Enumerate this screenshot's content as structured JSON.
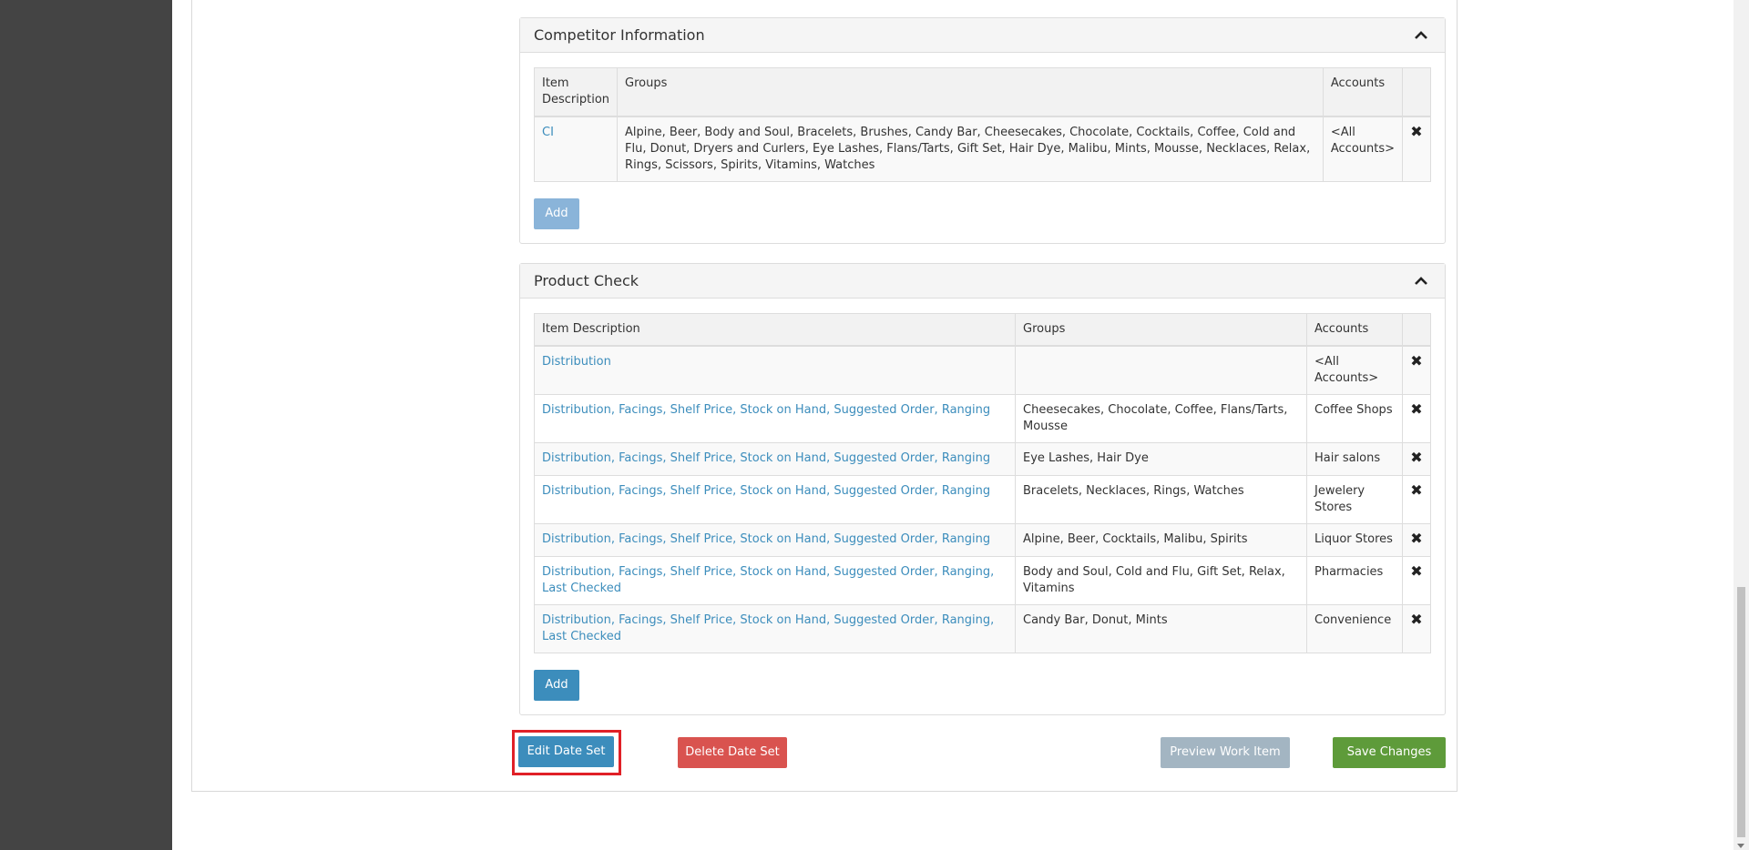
{
  "competitor_panel": {
    "title": "Competitor Information",
    "headers": [
      "Item Description",
      "Groups",
      "Accounts"
    ],
    "rows": [
      {
        "item": "CI",
        "groups": "Alpine, Beer, Body and Soul, Bracelets, Brushes, Candy Bar, Cheesecakes, Chocolate, Cocktails, Coffee, Cold and Flu, Donut, Dryers and Curlers, Eye Lashes, Flans/Tarts, Gift Set, Hair Dye, Malibu, Mints, Mousse, Necklaces, Relax, Rings, Scissors, Spirits, Vitamins, Watches",
        "accounts": "<All Accounts>"
      }
    ],
    "add_label": "Add"
  },
  "product_panel": {
    "title": "Product Check",
    "headers": [
      "Item Description",
      "Groups",
      "Accounts"
    ],
    "rows": [
      {
        "item": "Distribution",
        "groups": "",
        "accounts": "<All Accounts>"
      },
      {
        "item": "Distribution, Facings, Shelf Price, Stock on Hand, Suggested Order, Ranging",
        "groups": "Cheesecakes, Chocolate, Coffee, Flans/Tarts, Mousse",
        "accounts": "Coffee Shops"
      },
      {
        "item": "Distribution, Facings, Shelf Price, Stock on Hand, Suggested Order, Ranging",
        "groups": "Eye Lashes, Hair Dye",
        "accounts": "Hair salons"
      },
      {
        "item": "Distribution, Facings, Shelf Price, Stock on Hand, Suggested Order, Ranging",
        "groups": "Bracelets, Necklaces, Rings, Watches",
        "accounts": "Jewelery Stores"
      },
      {
        "item": "Distribution, Facings, Shelf Price, Stock on Hand, Suggested Order, Ranging",
        "groups": "Alpine, Beer, Cocktails, Malibu, Spirits",
        "accounts": "Liquor Stores"
      },
      {
        "item": "Distribution, Facings, Shelf Price, Stock on Hand, Suggested Order, Ranging, Last Checked",
        "groups": "Body and Soul, Cold and Flu, Gift Set, Relax, Vitamins",
        "accounts": "Pharmacies"
      },
      {
        "item": "Distribution, Facings, Shelf Price, Stock on Hand, Suggested Order, Ranging, Last Checked",
        "groups": "Candy Bar, Donut, Mints",
        "accounts": "Convenience"
      }
    ],
    "add_label": "Add"
  },
  "actions": {
    "edit_date_set": "Edit Date Set",
    "delete_date_set": "Delete Date Set",
    "preview_work_item": "Preview Work Item",
    "save_changes": "Save Changes"
  },
  "colors": {
    "link": "#3c8dbc",
    "primary": "#3c8dbc",
    "danger": "#d9534f",
    "success": "#5e9b3a",
    "disabled": "#a3b5c2",
    "highlight": "#e02027",
    "rail": "#444444"
  },
  "icons": {
    "collapse": "chevron-up-icon",
    "remove": "close-icon"
  }
}
